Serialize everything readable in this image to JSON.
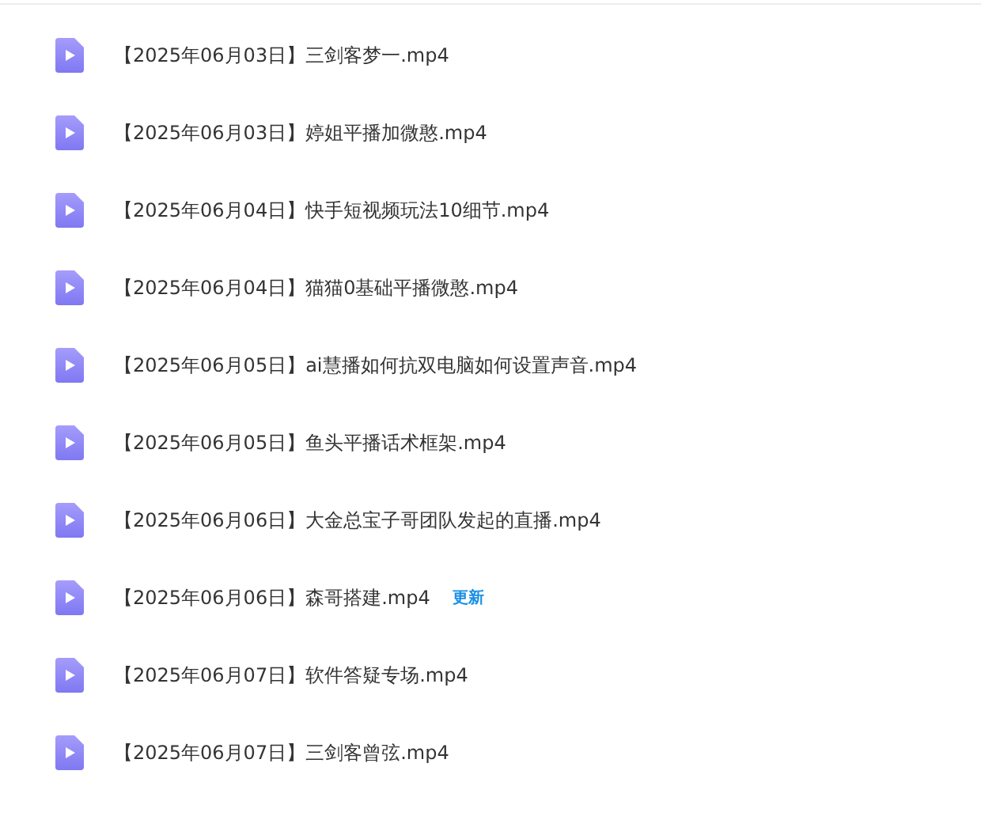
{
  "files": [
    {
      "name": "【2025年06月03日】三剑客梦一.mp4"
    },
    {
      "name": "【2025年06月03日】婷姐平播加微憨.mp4"
    },
    {
      "name": "【2025年06月04日】快手短视频玩法10细节.mp4"
    },
    {
      "name": "【2025年06月04日】猫猫0基础平播微憨.mp4"
    },
    {
      "name": "【2025年06月05日】ai慧播如何抗双电脑如何设置声音.mp4"
    },
    {
      "name": "【2025年06月05日】鱼头平播话术框架.mp4"
    },
    {
      "name": "【2025年06月06日】大金总宝子哥团队发起的直播.mp4"
    },
    {
      "name": "【2025年06月06日】森哥搭建.mp4",
      "badge": "更新"
    },
    {
      "name": "【2025年06月07日】软件答疑专场.mp4"
    },
    {
      "name": "【2025年06月07日】三剑客曾弦.mp4"
    }
  ]
}
